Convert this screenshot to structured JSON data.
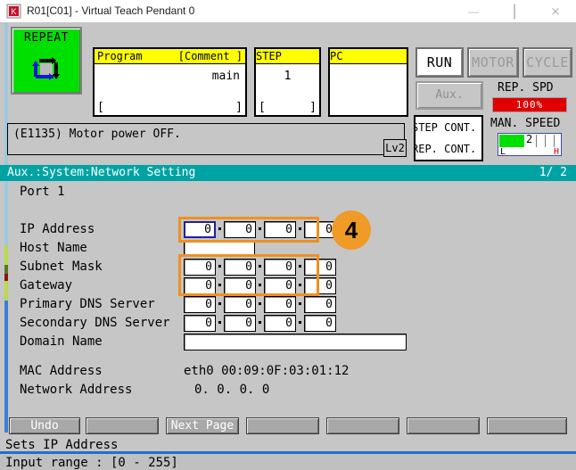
{
  "window": {
    "title": "R01[C01] - Virtual Teach Pendant 0",
    "icon": "app-icon",
    "minimize": "—",
    "maximize": "□",
    "close": "✕"
  },
  "statuspanel": {
    "mode_button": {
      "label": "REPEAT",
      "icon": "cycle-repeat-icon",
      "color": "#00e000"
    },
    "program": {
      "header_left": "Program",
      "header_right": "[Comment ]",
      "value": "main",
      "bracket_left": "[",
      "bracket_right": "]"
    },
    "step": {
      "header": "STEP",
      "value": "1",
      "bracket_left": "[",
      "bracket_right": "]"
    },
    "pc": {
      "header": "PC",
      "value": ""
    },
    "mode_buttons": [
      {
        "label": "RUN",
        "active": true
      },
      {
        "label": "MOTOR",
        "active": false
      },
      {
        "label": "CYCLE",
        "active": false
      }
    ],
    "aux_button": "Aux.",
    "cont_box": [
      "STEP CONT.",
      "REP. CONT."
    ],
    "rep_speed": {
      "label": "REP. SPD",
      "value": "100%",
      "color": "#e00000"
    },
    "man_speed": {
      "label": "MAN. SPEED",
      "value": "2",
      "low": "L",
      "high": "H",
      "fill_percent": 40,
      "color": "#00e000"
    }
  },
  "message": {
    "text": "(E1135) Motor power OFF.",
    "level": "Lv2"
  },
  "screen": {
    "title": "Aux.:System:Network Setting",
    "page": "1/  2",
    "port": "Port 1"
  },
  "form": {
    "fields": [
      {
        "label": "IP Address",
        "type": "octets",
        "values": [
          "0",
          "0",
          "0",
          "0"
        ],
        "focus": 0
      },
      {
        "label": "Host Name",
        "type": "text",
        "value": ""
      },
      {
        "label": "Subnet Mask",
        "type": "octets",
        "values": [
          "0",
          "0",
          "0",
          "0"
        ]
      },
      {
        "label": "Gateway",
        "type": "octets",
        "values": [
          "0",
          "0",
          "0",
          "0"
        ]
      },
      {
        "label": "Primary DNS Server",
        "type": "octets",
        "values": [
          "0",
          "0",
          "0",
          "0"
        ]
      },
      {
        "label": "Secondary DNS Server",
        "type": "octets",
        "values": [
          "0",
          "0",
          "0",
          "0"
        ]
      },
      {
        "label": "Domain Name",
        "type": "text",
        "value": ""
      }
    ],
    "highlight_color": "#f09020",
    "badge": "4"
  },
  "info": {
    "mac_label": "MAC Address",
    "mac_value": "eth0 00:09:0F:03:01:12",
    "netaddr_label": "Network Address",
    "netaddr_value": "0.  0.  0.  0"
  },
  "footer": {
    "buttons": [
      "Undo",
      "",
      "Next Page",
      "",
      "",
      "",
      ""
    ],
    "status_line1": "Sets IP Address",
    "status_line2": "Input range : [0  - 255]"
  }
}
